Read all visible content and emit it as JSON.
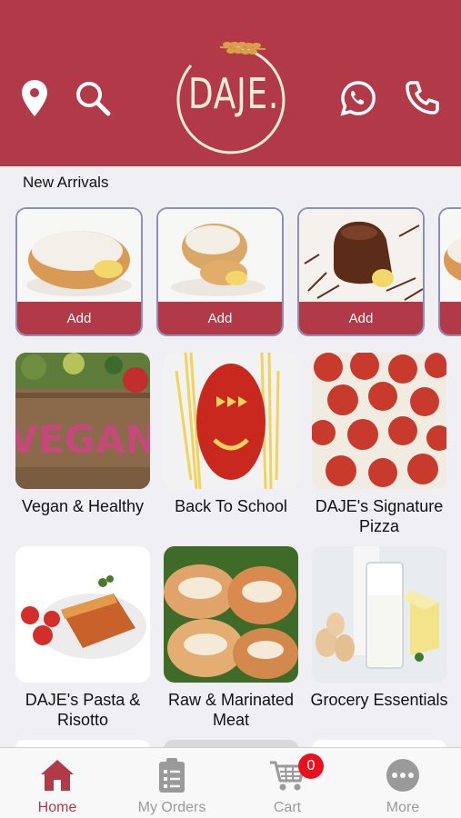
{
  "brand": {
    "logo_text": "DAJE.",
    "primary_color": "#b23a48",
    "logo_text_color": "#fbecd9"
  },
  "header_icons": [
    "location-pin-icon",
    "search-icon",
    "whatsapp-icon",
    "phone-icon"
  ],
  "new_arrivals": {
    "title": "New Arrivals",
    "items": [
      {
        "button": "Add",
        "image": "sugared-cream-donut"
      },
      {
        "button": "Add",
        "image": "cream-filled-pastry"
      },
      {
        "button": "Add",
        "image": "chocolate-eclair"
      }
    ]
  },
  "categories": [
    {
      "label": "Vegan & Healthy",
      "image": "vegan-vegetables"
    },
    {
      "label": "Back To School",
      "image": "pasta-face"
    },
    {
      "label": "DAJE's Signature Pizza",
      "image": "pepperoni-pizza"
    },
    {
      "label": "DAJE's Pasta & Risotto",
      "image": "lasagna"
    },
    {
      "label": "Raw & Marinated Meat",
      "image": "marinated-chicken"
    },
    {
      "label": "Grocery Essentials",
      "image": "milk-eggs-butter"
    }
  ],
  "tabbar": {
    "tabs": [
      {
        "label": "Home",
        "icon": "home-icon",
        "active": true
      },
      {
        "label": "My Orders",
        "icon": "clipboard-icon",
        "active": false
      },
      {
        "label": "Cart",
        "icon": "cart-icon",
        "active": false
      },
      {
        "label": "More",
        "icon": "more-dots-icon",
        "active": false
      }
    ],
    "cart_count": "0"
  }
}
